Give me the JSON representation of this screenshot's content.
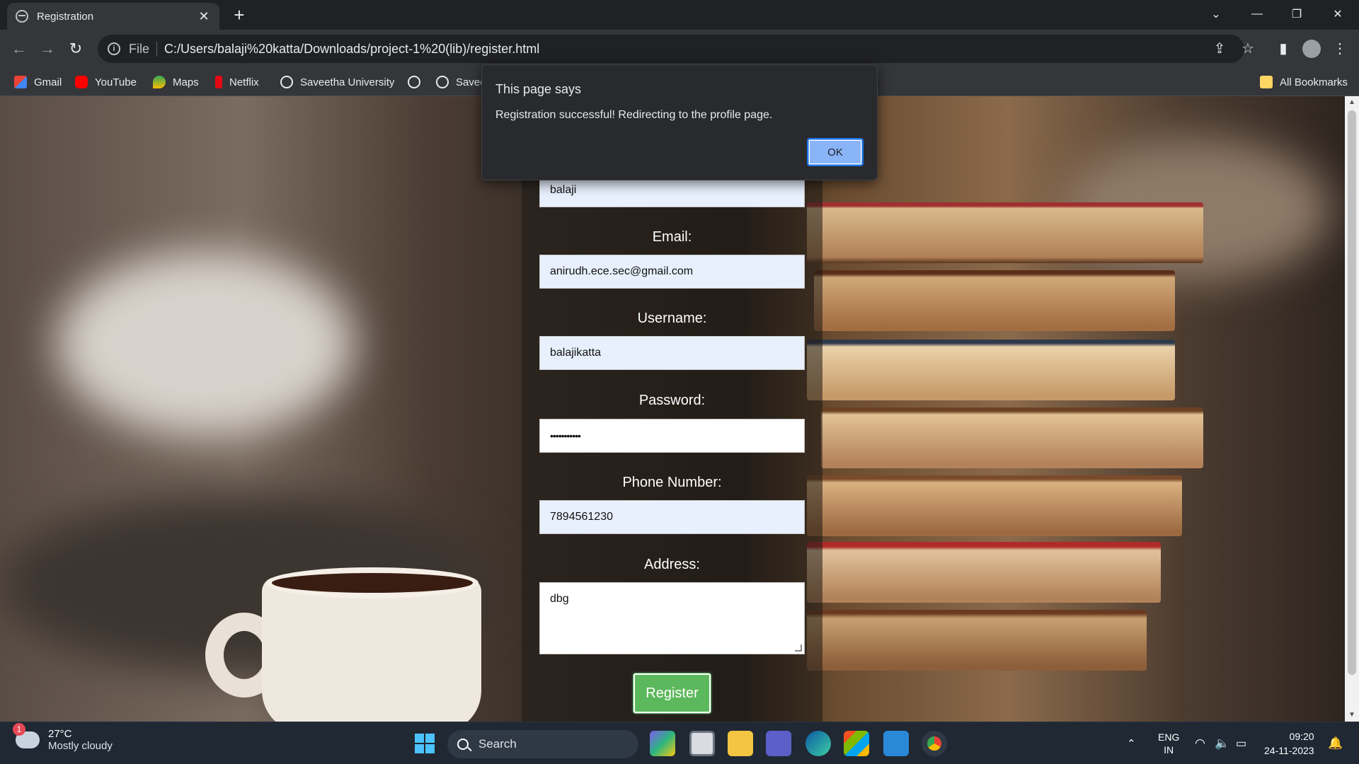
{
  "browser": {
    "tab_title": "Registration",
    "new_tab_symbol": "+",
    "address_scheme": "File",
    "address_url": "C:/Users/balaji%20katta/Downloads/project-1%20(lib)/register.html",
    "bookmarks": [
      "Gmail",
      "YouTube",
      "Maps",
      "Netflix",
      "Saveetha University",
      "",
      "Savee"
    ],
    "all_bookmarks": "All Bookmarks"
  },
  "form": {
    "name_value": "balaji",
    "email_label": "Email:",
    "email_value": "anirudh.ece.sec@gmail.com",
    "username_label": "Username:",
    "username_value": "balajikatta",
    "password_label": "Password:",
    "password_value": "•••••••••••",
    "phone_label": "Phone Number:",
    "phone_value": "7894561230",
    "address_label": "Address:",
    "address_value": "dbg",
    "register_label": "Register"
  },
  "dialog": {
    "title": "This page says",
    "message": "Registration successful! Redirecting to the profile page.",
    "ok_label": "OK"
  },
  "taskbar": {
    "weather_badge": "1",
    "temperature": "27°C",
    "condition": "Mostly cloudy",
    "search_placeholder": "Search",
    "language": "ENG",
    "region": "IN",
    "time": "09:20",
    "date": "24-11-2023"
  },
  "colors": {
    "register_button": "#5cb85c",
    "ok_button": "#8ab4f8",
    "field_autofill": "#e8f0fe"
  }
}
